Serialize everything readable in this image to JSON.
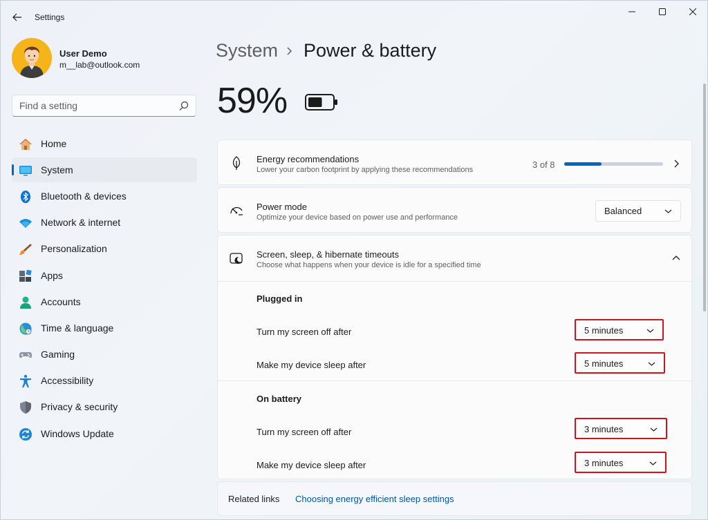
{
  "window": {
    "title": "Settings"
  },
  "profile": {
    "name": "User Demo",
    "email": "m__lab@outlook.com"
  },
  "search": {
    "placeholder": "Find a setting"
  },
  "sidebar": {
    "items": [
      {
        "label": "Home",
        "icon": "home-icon"
      },
      {
        "label": "System",
        "icon": "system-icon",
        "active": true
      },
      {
        "label": "Bluetooth & devices",
        "icon": "bluetooth-icon"
      },
      {
        "label": "Network & internet",
        "icon": "wifi-icon"
      },
      {
        "label": "Personalization",
        "icon": "brush-icon"
      },
      {
        "label": "Apps",
        "icon": "apps-icon"
      },
      {
        "label": "Accounts",
        "icon": "accounts-icon"
      },
      {
        "label": "Time & language",
        "icon": "globe-icon"
      },
      {
        "label": "Gaming",
        "icon": "gamepad-icon"
      },
      {
        "label": "Accessibility",
        "icon": "accessibility-icon"
      },
      {
        "label": "Privacy & security",
        "icon": "shield-icon"
      },
      {
        "label": "Windows Update",
        "icon": "update-icon"
      }
    ]
  },
  "header": {
    "parent": "System",
    "current": "Power & battery"
  },
  "battery": {
    "percent_text": "59%",
    "level": 0.59
  },
  "energy": {
    "title": "Energy recommendations",
    "subtitle": "Lower your carbon footprint by applying these recommendations",
    "progress_text": "3 of 8",
    "progress": 0.375
  },
  "power_mode": {
    "title": "Power mode",
    "subtitle": "Optimize your device based on power use and performance",
    "value": "Balanced"
  },
  "timeouts": {
    "title": "Screen, sleep, & hibernate timeouts",
    "subtitle": "Choose what happens when your device is idle for a specified time",
    "plugged_in": {
      "heading": "Plugged in",
      "screen_label": "Turn my screen off after",
      "screen_value": "5 minutes",
      "sleep_label": "Make my device sleep after",
      "sleep_value": "5 minutes"
    },
    "on_battery": {
      "heading": "On battery",
      "screen_label": "Turn my screen off after",
      "screen_value": "3 minutes",
      "sleep_label": "Make my device sleep after",
      "sleep_value": "3 minutes"
    }
  },
  "related": {
    "label": "Related links",
    "link": "Choosing energy efficient sleep settings"
  },
  "colors": {
    "accent": "#0067c0",
    "highlight": "#d0121f"
  }
}
